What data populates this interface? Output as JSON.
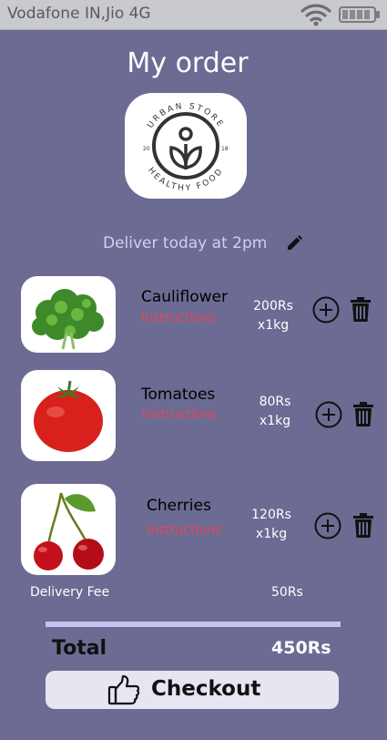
{
  "status_bar": {
    "carrier": "Vodafone IN,Jio 4G",
    "icons": [
      "wifi-icon",
      "battery-icon"
    ]
  },
  "header": {
    "title": "My order"
  },
  "logo": {
    "top_text": "URBAN STORE",
    "bottom_text": "HEALTHY FOOD",
    "year_left": "20",
    "year_right": "18",
    "icon": "store-logo"
  },
  "delivery": {
    "text": "Deliver today at 2pm",
    "icon": "pencil-icon"
  },
  "items": [
    {
      "name": "Cauliflower",
      "instructions": "Instructions",
      "price": "200Rs",
      "qty": "x1kg",
      "image": "kale-image"
    },
    {
      "name": "Tomatoes",
      "instructions": "Instructions",
      "price": "80Rs",
      "qty": "x1kg",
      "image": "tomato-image"
    },
    {
      "name": "Cherries",
      "instructions": "Instructions",
      "price": "120Rs",
      "qty": "x1kg",
      "image": "cherries-image"
    }
  ],
  "summary": {
    "delivery_fee_label": "Delivery Fee",
    "delivery_fee_value": "50Rs",
    "total_label": "Total",
    "total_value": "450Rs"
  },
  "checkout": {
    "label": "Checkout",
    "icon": "thumbs-up-icon"
  },
  "colors": {
    "background": "#6b6b93",
    "instructions": "#e6475a",
    "divider": "#c4c4f4",
    "button": "#e7e5f0"
  }
}
